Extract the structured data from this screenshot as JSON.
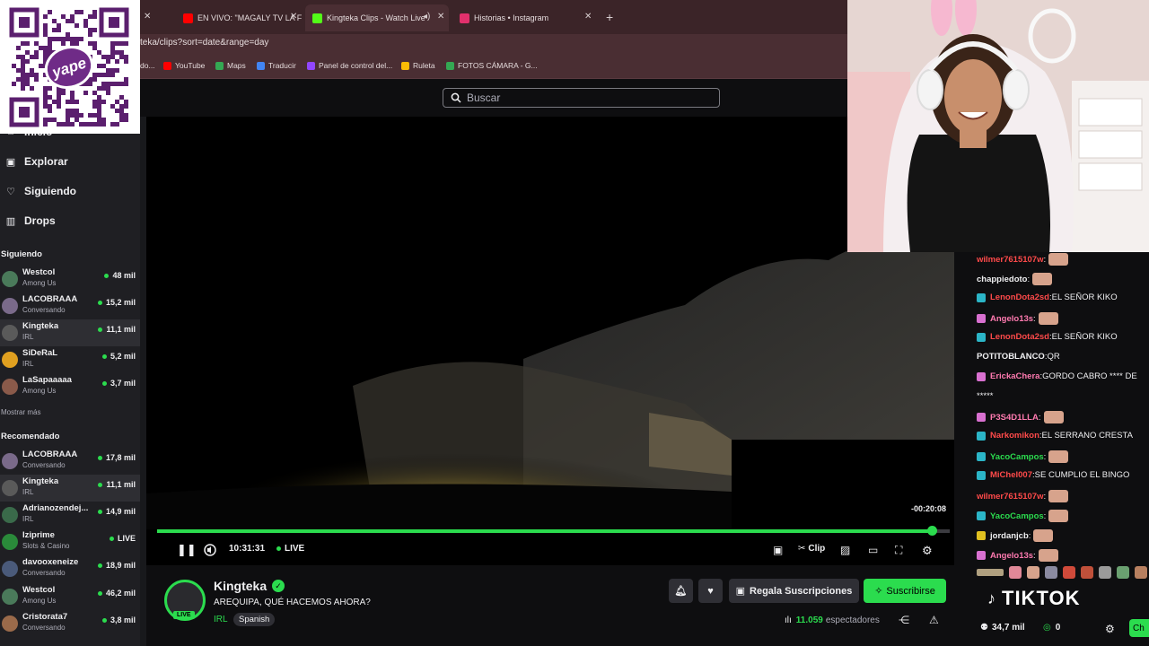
{
  "browser": {
    "tabs": [
      {
        "label": "EN VIVO: \"MAGALY TV LA FI",
        "color": "#ff0000"
      },
      {
        "label": "Kingteka Clips - Watch Live",
        "color": "#53fc18"
      },
      {
        "label": "Historias • Instagram",
        "color": "#e1306c"
      }
    ],
    "new_tab": "+",
    "url": "teka/clips?sort=date&range=day",
    "bookmarks": [
      {
        "label": "do...",
        "color": "#8a8a8a"
      },
      {
        "label": "YouTube",
        "color": "#ff0000"
      },
      {
        "label": "Maps",
        "color": "#34a853"
      },
      {
        "label": "Traducir",
        "color": "#4285f4"
      },
      {
        "label": "Panel de control del...",
        "color": "#9146ff"
      },
      {
        "label": "Ruleta",
        "color": "#fbbc05"
      },
      {
        "label": "FOTOS CÁMARA - G...",
        "color": "#34a853"
      }
    ]
  },
  "search": {
    "placeholder": "Buscar"
  },
  "sidebar": {
    "nav": [
      {
        "label": "Inicio",
        "icon": "home-icon"
      },
      {
        "label": "Explorar",
        "icon": "browse-icon"
      },
      {
        "label": "Siguiendo",
        "icon": "heart-icon"
      },
      {
        "label": "Drops",
        "icon": "drops-icon"
      }
    ],
    "following_header": "Siguiendo",
    "following": [
      {
        "name": "Westcol",
        "game": "Among Us",
        "viewers": "48 mil",
        "color": "#4a7a5a"
      },
      {
        "name": "LACOBRAAA",
        "game": "Conversando",
        "viewers": "15,2 mil",
        "color": "#7a6a8a"
      },
      {
        "name": "Kingteka",
        "game": "IRL",
        "viewers": "11,1 mil",
        "color": "#5a5a5a"
      },
      {
        "name": "SiDeRaL",
        "game": "IRL",
        "viewers": "5,2 mil",
        "color": "#e0a020"
      },
      {
        "name": "LaSapaaaaa",
        "game": "Among Us",
        "viewers": "3,7 mil",
        "color": "#8a5a4a"
      }
    ],
    "show_more": "Mostrar más",
    "recommended_header": "Recomendado",
    "recommended": [
      {
        "name": "LACOBRAAA",
        "game": "Conversando",
        "viewers": "17,8 mil",
        "color": "#7a6a8a"
      },
      {
        "name": "Kingteka",
        "game": "IRL",
        "viewers": "11,1 mil",
        "color": "#5a5a5a"
      },
      {
        "name": "Adrianozendej...",
        "game": "IRL",
        "viewers": "14,9 mil",
        "color": "#3a6a4a"
      },
      {
        "name": "Iziprime",
        "game": "Slots & Casino",
        "viewers": "LIVE",
        "color": "#2a8a3a"
      },
      {
        "name": "davooxeneize",
        "game": "Conversando",
        "viewers": "18,9 mil",
        "color": "#4a5a7a"
      },
      {
        "name": "Westcol",
        "game": "Among Us",
        "viewers": "46,2 mil",
        "color": "#4a7a5a"
      },
      {
        "name": "Cristorata7",
        "game": "Conversando",
        "viewers": "3,8 mil",
        "color": "#9a6a4a"
      }
    ]
  },
  "player": {
    "time_remaining": "-00:20:08",
    "progress": 0.977,
    "elapsed": "10:31:31",
    "live": "LIVE",
    "clip_label": "Clip"
  },
  "stream": {
    "streamer": "Kingteka",
    "live_tag": "LIVE",
    "title": "AREQUIPA, QUÉ HACEMOS AHORA?",
    "category": "IRL",
    "language": "Spanish",
    "gift_label": "Regala Suscripciones",
    "subscribe_label": "Suscribirse",
    "viewers_count": "11.059",
    "viewers_label": "espectadores"
  },
  "chat": {
    "messages": [
      {
        "user": "wilmer7615107w",
        "user_color": "#ff4a4a",
        "text": "",
        "badge": "",
        "emote": true
      },
      {
        "user": "chappiedoto",
        "user_color": "#efeff1",
        "text": "",
        "badge": "",
        "emote": true
      },
      {
        "user": "LenonDota2sd",
        "user_color": "#ff4a4a",
        "text": "EL SEÑOR KIKO",
        "badge": "#2bb5c7",
        "emote": false
      },
      {
        "user": "Angelo13s",
        "user_color": "#ff7ab0",
        "text": "",
        "badge": "#d870d0",
        "emote": true
      },
      {
        "user": "LenonDota2sd",
        "user_color": "#ff4a4a",
        "text": "EL SEÑOR KIKO",
        "badge": "#2bb5c7",
        "emote": false
      },
      {
        "user": "POTITOBLANCO",
        "user_color": "#efeff1",
        "text": "QR",
        "badge": "",
        "emote": false
      },
      {
        "user": "ErickaChera",
        "user_color": "#ff7ab0",
        "text": "GORDO CABRO **** DE",
        "badge": "#d870d0",
        "emote": false
      },
      {
        "user": "",
        "user_color": "#efeff1",
        "text": "*****",
        "badge": "",
        "emote": false
      },
      {
        "user": "P3S4D1LLA",
        "user_color": "#ff7ab0",
        "text": "",
        "badge": "#d870d0",
        "emote": true
      },
      {
        "user": "Narkomikon",
        "user_color": "#ff4a4a",
        "text": "EL SERRANO CRESTA",
        "badge": "#2bb5c7",
        "emote": false
      },
      {
        "user": "YacoCampos",
        "user_color": "#2bdc4e",
        "text": "",
        "badge": "#2bb5c7",
        "emote": true
      },
      {
        "user": "MiChel007",
        "user_color": "#ff4a4a",
        "text": "SE CUMPLIO EL BINGO",
        "badge": "#2bb5c7",
        "emote": false
      },
      {
        "user": "wilmer7615107w",
        "user_color": "#ff4a4a",
        "text": "",
        "badge": "",
        "emote": true
      },
      {
        "user": "YacoCampos",
        "user_color": "#2bdc4e",
        "text": "",
        "badge": "#2bb5c7",
        "emote": true
      },
      {
        "user": "jordanjcb",
        "user_color": "#efeff1",
        "text": "",
        "badge": "#e0c020",
        "emote": true
      },
      {
        "user": "Angelo13s",
        "user_color": "#ff7ab0",
        "text": "",
        "badge": "#d870d0",
        "emote": true
      }
    ],
    "banner": "TIKTOK",
    "followers": "34,7 mil",
    "points": "0",
    "chat_button": "Ch"
  },
  "overlay": {
    "qr_brand": "yape"
  }
}
